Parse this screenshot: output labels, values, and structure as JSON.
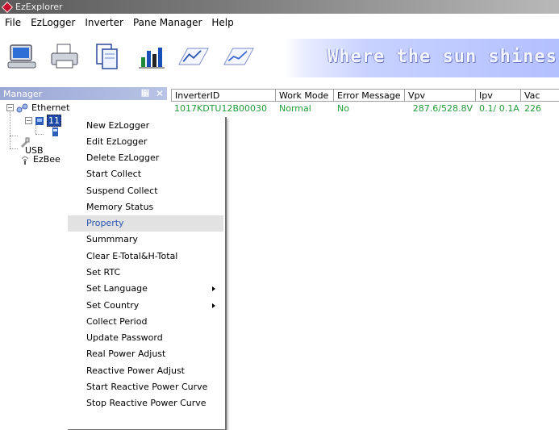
{
  "window": {
    "title": "EzExplorer"
  },
  "menubar": {
    "items": [
      "File",
      "EzLogger",
      "Inverter",
      "Pane Manager",
      "Help"
    ]
  },
  "toolbar": {
    "buttons": [
      "computer-icon",
      "printer-icon",
      "documents-icon",
      "bar-chart-icon",
      "line-chart-icon",
      "line-chart-icon"
    ],
    "banner": "Where the sun shines, th"
  },
  "manager": {
    "title": "Manager",
    "pin_glyph": "੼",
    "close_glyph": "✕",
    "tree": {
      "ethernet": "Ethernet",
      "device_prefix": "11",
      "usb": "USB",
      "ezbee": "EzBee"
    }
  },
  "grid": {
    "columns": [
      "InverterID",
      "Work Mode",
      "Error Message",
      "Vpv",
      "Ipv",
      "Vac"
    ],
    "rows": [
      [
        "1017KDTU12B00030",
        "Normal",
        "No",
        "287.6/528.8V",
        "0.1/ 0.1A",
        "226"
      ]
    ]
  },
  "context_menu": {
    "items": [
      {
        "label": "New EzLogger"
      },
      {
        "label": "Edit EzLogger"
      },
      {
        "label": "Delete EzLogger"
      },
      {
        "label": "Start Collect"
      },
      {
        "label": "Suspend Collect"
      },
      {
        "label": "Memory Status"
      },
      {
        "label": "Property",
        "selected": true
      },
      {
        "label": "Summmary"
      },
      {
        "label": "Clear E-Total&H-Total"
      },
      {
        "label": "Set RTC"
      },
      {
        "label": "Set Language",
        "submenu": true
      },
      {
        "label": "Set Country",
        "submenu": true
      },
      {
        "label": "Collect Period"
      },
      {
        "label": "Update Password"
      },
      {
        "label": "Real Power Adjust"
      },
      {
        "label": "Reactive Power Adjust"
      },
      {
        "label": "Start Reactive Power Curve"
      },
      {
        "label": "Stop Reactive Power Curve"
      }
    ]
  },
  "colors": {
    "data_row_text": "#239c3b",
    "selected_item_text": "#2a55b0",
    "manager_header": "#9aa7d4"
  }
}
